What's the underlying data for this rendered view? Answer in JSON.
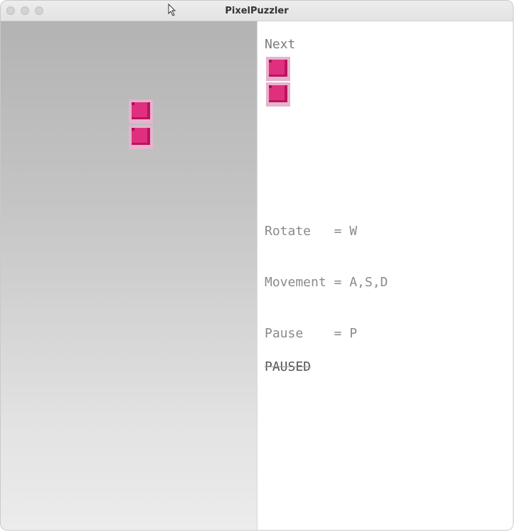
{
  "window": {
    "title": "PixelPuzzler"
  },
  "board": {
    "falling_piece": {
      "cells": 2,
      "color": "#e02f7f"
    }
  },
  "panel": {
    "next_label": "Next",
    "next_piece": {
      "cells": 2,
      "color": "#e02f7f"
    },
    "controls": {
      "rotate": "Rotate   = W",
      "movement": "Movement = A,S,D",
      "pause": "Pause    = P"
    },
    "status": "PAUSED"
  },
  "colors": {
    "piece_primary": "#e02f7f",
    "piece_shadow": "#b9155c",
    "piece_border": "#e6b3cc",
    "board_top": "#b3b3b3",
    "board_bottom": "#ececec"
  }
}
